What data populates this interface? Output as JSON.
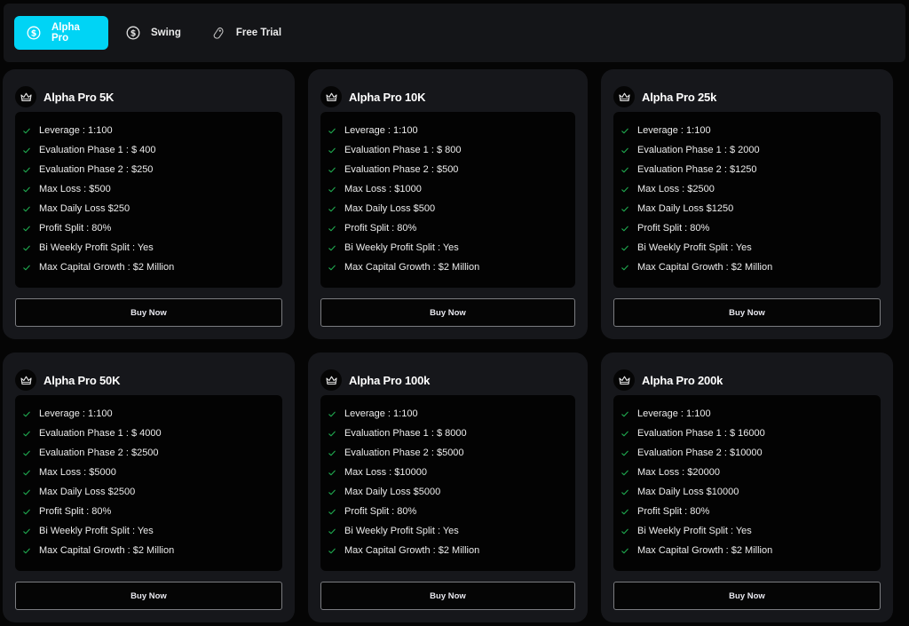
{
  "tabs": [
    {
      "label": "Alpha Pro",
      "icon": "dollar-circle-icon",
      "active": true
    },
    {
      "label": "Swing",
      "icon": "dollar-circle-icon",
      "active": false
    },
    {
      "label": "Free Trial",
      "icon": "tag-icon",
      "active": false
    }
  ],
  "colors": {
    "accent": "#00d4f5",
    "check": "#1fa84f",
    "card_bg": "#16171b"
  },
  "plans": [
    {
      "title": "Alpha Pro 5K",
      "features": [
        "Leverage : 1:100",
        "Evaluation Phase 1 : $ 400",
        "Evaluation Phase 2 : $250",
        "Max Loss : $500",
        "Max Daily Loss $250",
        "Profit Split : 80%",
        "Bi Weekly Profit Split : Yes",
        "Max Capital Growth : $2 Million"
      ],
      "button": "Buy Now"
    },
    {
      "title": "Alpha Pro 10K",
      "features": [
        "Leverage : 1:100",
        "Evaluation Phase 1 : $ 800",
        "Evaluation Phase 2 : $500",
        "Max Loss : $1000",
        "Max Daily Loss $500",
        "Profit Split : 80%",
        "Bi Weekly Profit Split : Yes",
        "Max Capital Growth : $2 Million"
      ],
      "button": "Buy Now"
    },
    {
      "title": "Alpha Pro 25k",
      "features": [
        "Leverage : 1:100",
        "Evaluation Phase 1 : $ 2000",
        "Evaluation Phase 2 : $1250",
        "Max Loss : $2500",
        "Max Daily Loss $1250",
        "Profit Split : 80%",
        "Bi Weekly Profit Split : Yes",
        "Max Capital Growth : $2 Million"
      ],
      "button": "Buy Now"
    },
    {
      "title": "Alpha Pro 50K",
      "features": [
        "Leverage : 1:100",
        "Evaluation Phase 1 : $ 4000",
        "Evaluation Phase 2 : $2500",
        "Max Loss : $5000",
        "Max Daily Loss $2500",
        "Profit Split : 80%",
        "Bi Weekly Profit Split : Yes",
        "Max Capital Growth : $2 Million"
      ],
      "button": "Buy Now"
    },
    {
      "title": "Alpha Pro 100k",
      "features": [
        "Leverage : 1:100",
        "Evaluation Phase 1 : $ 8000",
        "Evaluation Phase 2 : $5000",
        "Max Loss : $10000",
        "Max Daily Loss $5000",
        "Profit Split : 80%",
        "Bi Weekly Profit Split : Yes",
        "Max Capital Growth : $2 Million"
      ],
      "button": "Buy Now"
    },
    {
      "title": "Alpha Pro 200k",
      "features": [
        "Leverage : 1:100",
        "Evaluation Phase 1 : $ 16000",
        "Evaluation Phase 2 : $10000",
        "Max Loss : $20000",
        "Max Daily Loss $10000",
        "Profit Split : 80%",
        "Bi Weekly Profit Split : Yes",
        "Max Capital Growth : $2 Million"
      ],
      "button": "Buy Now"
    }
  ]
}
